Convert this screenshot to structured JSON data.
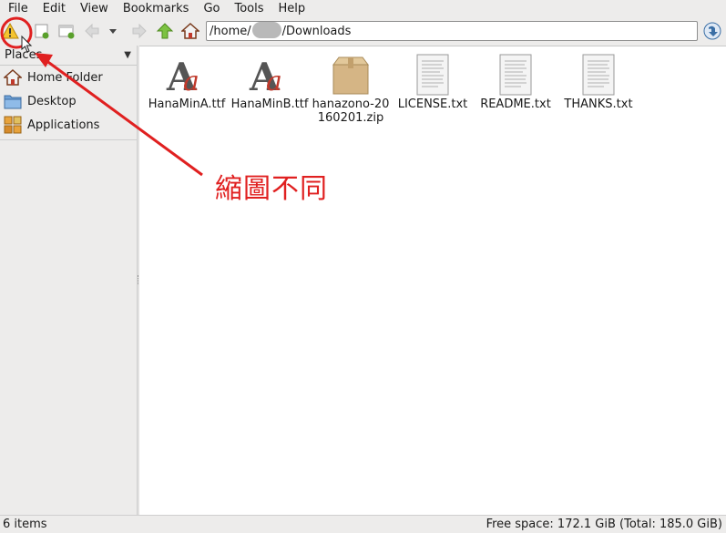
{
  "menu": [
    "File",
    "Edit",
    "View",
    "Bookmarks",
    "Go",
    "Tools",
    "Help"
  ],
  "path": {
    "prefix": "/home/",
    "suffix": "/Downloads"
  },
  "sidebar": {
    "header": "Places",
    "items": [
      {
        "label": "Home Folder",
        "icon": "home-folder-icon"
      },
      {
        "label": "Desktop",
        "icon": "desktop-folder-icon"
      },
      {
        "label": "Applications",
        "icon": "applications-icon"
      }
    ]
  },
  "files": [
    {
      "name": "HanaMinA.ttf",
      "icon": "font-file-icon"
    },
    {
      "name": "HanaMinB.ttf",
      "icon": "font-file-icon"
    },
    {
      "name": "hanazono-20160201.zip",
      "icon": "archive-box-icon"
    },
    {
      "name": "LICENSE.txt",
      "icon": "text-file-icon"
    },
    {
      "name": "README.txt",
      "icon": "text-file-icon"
    },
    {
      "name": "THANKS.txt",
      "icon": "text-file-icon"
    }
  ],
  "status": {
    "items": "6 items",
    "free_space": "Free space: 172.1 GiB (Total: 185.0 GiB)"
  },
  "annotation": {
    "text": "縮圖不同",
    "color": "#e02020"
  }
}
